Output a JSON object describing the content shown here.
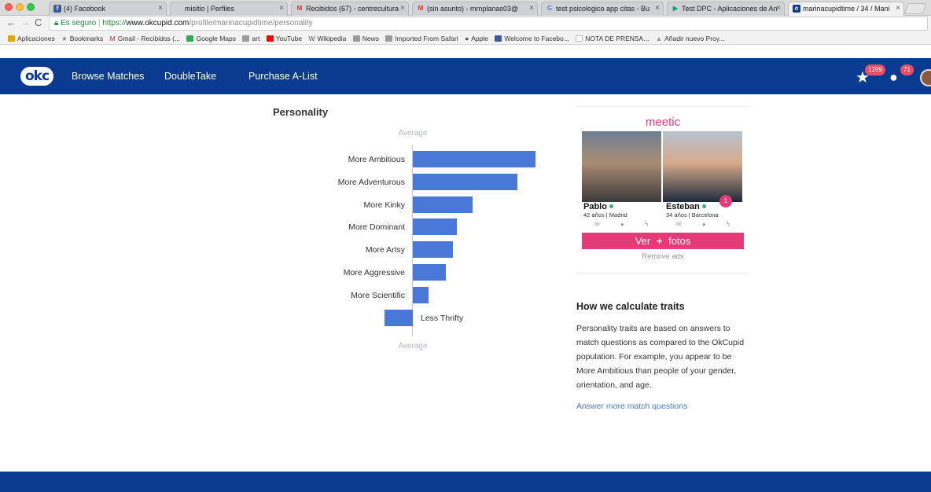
{
  "browser": {
    "tabs": [
      {
        "label": "(4) Facebook",
        "favicon": "facebook-icon",
        "color": "#3b5998"
      },
      {
        "label": "misitio | Perfiles",
        "favicon": "page-icon",
        "color": "#888888"
      },
      {
        "label": "Recibidos (67) - centrecultura",
        "favicon": "gmail-icon",
        "color": "#d93025"
      },
      {
        "label": "(sin asunto) - mrnplanas03@",
        "favicon": "gmail-icon",
        "color": "#d93025"
      },
      {
        "label": "test psicologico app citas - Bu",
        "favicon": "google-icon",
        "color": "#4285f4"
      },
      {
        "label": "Test DPC - Aplicaciones de An",
        "favicon": "play-icon",
        "color": "#00a173"
      },
      {
        "label": "marinacupidtime / 34 / Mani",
        "favicon": "okc-icon",
        "color": "#0b3a91"
      }
    ],
    "close_glyph": "×",
    "secure_label": "Es seguro",
    "url_scheme": "https://",
    "url_host": "www.okcupid.com",
    "url_path": "/profile/marinacupidtime/personality",
    "bookmarks": [
      {
        "label": "Aplicaciones",
        "icon": "apps-icon",
        "color": "#e0a800"
      },
      {
        "label": "Bookmarks",
        "icon": "star-icon",
        "color": "#888888"
      },
      {
        "label": "Gmail - Recibidos (...",
        "icon": "gmail-icon",
        "color": "#d93025"
      },
      {
        "label": "Google Maps",
        "icon": "maps-icon",
        "color": "#34a853"
      },
      {
        "label": "art",
        "icon": "folder-icon",
        "color": "#9a9a9a"
      },
      {
        "label": "YouTube",
        "icon": "youtube-icon",
        "color": "#ff0000"
      },
      {
        "label": "Wikipedia",
        "icon": "wikipedia-icon",
        "color": "#555555"
      },
      {
        "label": "News",
        "icon": "folder-icon",
        "color": "#9a9a9a"
      },
      {
        "label": "Imported From Safari",
        "icon": "folder-icon",
        "color": "#9a9a9a"
      },
      {
        "label": "Apple",
        "icon": "apple-icon",
        "color": "#555555"
      },
      {
        "label": "Welcome to Facebo...",
        "icon": "facebook-icon",
        "color": "#3b5998"
      },
      {
        "label": "NOTA DE PRENSA...",
        "icon": "document-icon",
        "color": "#bbbbbb"
      },
      {
        "label": "Añadir nuevo Proy...",
        "icon": "drive-icon",
        "color": "#999999"
      }
    ]
  },
  "header": {
    "logo": "okc",
    "nav": [
      "Browse Matches",
      "DoubleTake",
      "Purchase A-List"
    ],
    "stars_badge": "1299",
    "messages_badge": "71"
  },
  "personality": {
    "title": "Personality",
    "average_label": "Average"
  },
  "chart_data": {
    "type": "bar",
    "orientation": "horizontal",
    "title": "Personality",
    "center_label": "Average",
    "categories": [
      "More Ambitious",
      "More Adventurous",
      "More Kinky",
      "More Dominant",
      "More Artsy",
      "More Aggressive",
      "More Scientific",
      "Less Thrifty"
    ],
    "values": [
      1.0,
      0.85,
      0.49,
      0.36,
      0.33,
      0.27,
      0.13,
      -0.23
    ],
    "color": "#4a78d9"
  },
  "ad": {
    "brand": "meetic",
    "person1": {
      "name": "Pablo",
      "meta": "42 años | Madrid"
    },
    "person2": {
      "name": "Esteban",
      "meta": "34 años | Barcelona"
    },
    "bubble_count": "1",
    "icons": "✉ ● ϟ",
    "cta_left": "Ver",
    "cta_plus": "+",
    "cta_right": "fotos",
    "remove_ads": "Remove ads"
  },
  "info": {
    "title": "How we calculate traits",
    "body": "Personality traits are based on answers to match questions as compared to the OkCupid population. For example, you appear to be More Ambitious than people of your gender, orientation, and age.",
    "link": "Answer more match questions"
  },
  "colors": {
    "brand_blue": "#0b3a91",
    "bar_blue": "#4a78d9",
    "meetic_pink": "#e33b76",
    "badge_red": "#e94f64"
  }
}
